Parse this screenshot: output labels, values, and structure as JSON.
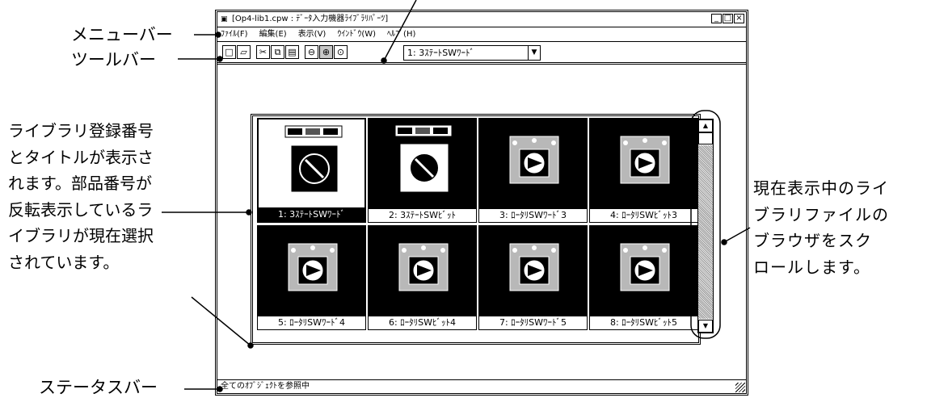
{
  "window": {
    "title": "[Op4-lib1.cpw : ﾃﾞｰﾀ入力機器ﾗｲﾌﾞﾗﾘﾊﾟｰﾂ]",
    "icon": "app-icon",
    "controls": [
      "minimize",
      "maximize",
      "close"
    ]
  },
  "menubar": {
    "items": [
      {
        "label": "ﾌｧｲﾙ(F)"
      },
      {
        "label": "編集(E)"
      },
      {
        "label": "表示(V)"
      },
      {
        "label": "ｳｲﾝﾄﾞｳ(W)"
      },
      {
        "label": "ﾍﾙﾌﾟ(H)"
      }
    ]
  },
  "toolbar": {
    "buttons": [
      "new-icon",
      "open-icon",
      "cut-icon",
      "copy-icon",
      "paste-icon",
      "zoom-out-icon",
      "zoom-in-icon",
      "zoom-reset-icon"
    ],
    "library_select": {
      "value": "1: 3ｽﾃｰﾄSWﾜｰﾄﾞ"
    }
  },
  "library_items": [
    {
      "label": "1: 3ｽﾃｰﾄSWﾜｰﾄﾞ",
      "selected": true,
      "kind": "3state"
    },
    {
      "label": "2: 3ｽﾃｰﾄSWﾋﾞｯﾄ",
      "selected": false,
      "kind": "3state"
    },
    {
      "label": "3: ﾛｰﾀﾘSWﾜｰﾄﾞ3",
      "selected": false,
      "kind": "rotary3"
    },
    {
      "label": "4: ﾛｰﾀﾘSWﾋﾞｯﾄ3",
      "selected": false,
      "kind": "rotary3"
    },
    {
      "label": "5: ﾛｰﾀﾘSWﾜｰﾄﾞ4",
      "selected": false,
      "kind": "rotary4"
    },
    {
      "label": "6: ﾛｰﾀﾘSWﾋﾞｯﾄ4",
      "selected": false,
      "kind": "rotary4"
    },
    {
      "label": "7: ﾛｰﾀﾘSWﾜｰﾄﾞ5",
      "selected": false,
      "kind": "rotary5"
    },
    {
      "label": "8: ﾛｰﾀﾘSWﾋﾞｯﾄ5",
      "selected": false,
      "kind": "rotary5"
    }
  ],
  "statusbar": {
    "text": "全てのｵﾌﾞｼﾞｪｸﾄを参照中"
  },
  "annotations": {
    "menubar": "メニューバー",
    "toolbar": "ツールバー",
    "statusbar": "ステータスバー",
    "library_label": [
      "ライブラリ登録番号",
      "とタイトルが表示さ",
      "れます。部品番号が",
      "反転表示しているラ",
      "イブラリが現在選択",
      "されています。"
    ],
    "scroll_label": [
      "現在表示中のライ",
      "ブラリファイルの",
      "ブラウザをスク",
      "ロールします。"
    ]
  }
}
